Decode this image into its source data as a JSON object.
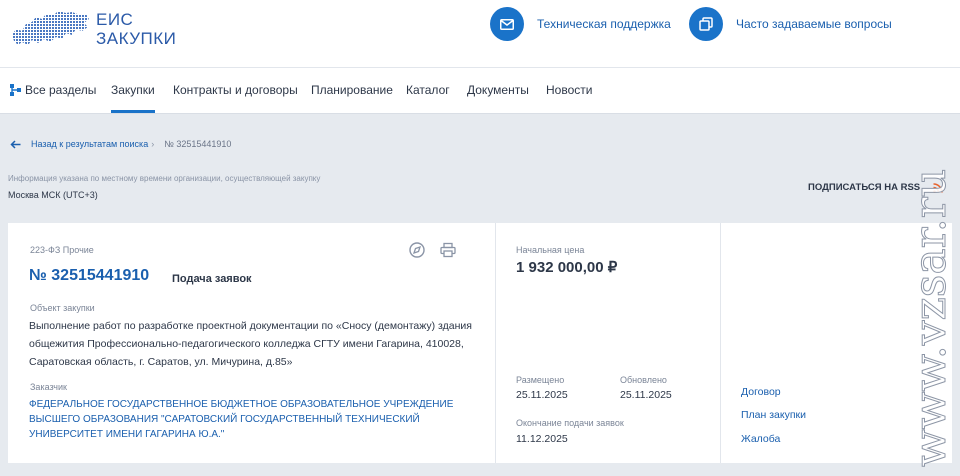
{
  "header": {
    "logo_line1": "ЕИС",
    "logo_line2": "ЗАКУПКИ",
    "support_label": "Техническая поддержка",
    "faq_label": "Часто задаваемые вопросы",
    "accent_color": "#1a73c9"
  },
  "nav": {
    "items": [
      "Все разделы",
      "Закупки",
      "Контракты и договоры",
      "Планирование",
      "Каталог",
      "Документы",
      "Новости"
    ],
    "active": "Закупки"
  },
  "breadcrumb": {
    "back_label": "Назад к результатам поиска",
    "current": "№ 32515441910"
  },
  "timezone": {
    "note": "Информация указана по местному времени организации, осуществляющей закупку",
    "value": "Москва МСК (UTC+3)"
  },
  "rss_label": "ПОДПИСАТЬСЯ НА RSS",
  "procurement": {
    "law": "223-ФЗ Прочие",
    "number": "№ 32515441910",
    "stage": "Подача заявок",
    "object_label": "Объект закупки",
    "object_text": "Выполнение работ по разработке проектной документации по «Сносу (демонтажу) здания общежития Профессионально-педагогического колледжа СГТУ имени Гагарина, 410028, Саратовская область, г. Саратов, ул. Мичурина, д.85»",
    "customer_label": "Заказчик",
    "customer_text": "ФЕДЕРАЛЬНОЕ ГОСУДАРСТВЕННОЕ БЮДЖЕТНОЕ ОБРАЗОВАТЕЛЬНОЕ УЧРЕЖДЕНИЕ ВЫСШЕГО ОБРАЗОВАНИЯ \"САРАТОВСКИЙ ГОСУДАРСТВЕННЫЙ ТЕХНИЧЕСКИЙ УНИВЕРСИТЕТ ИМЕНИ ГАГАРИНА Ю.А.\"",
    "price_label": "Начальная цена",
    "price": "1 932 000,00 ₽",
    "posted_label": "Размещено",
    "posted": "25.11.2025",
    "updated_label": "Обновлено",
    "updated": "25.11.2025",
    "deadline_label": "Окончание подачи заявок",
    "deadline": "11.12.2025"
  },
  "links": [
    "Договор",
    "План закупки",
    "Жалоба"
  ],
  "watermark": "www.vzsar.ru"
}
